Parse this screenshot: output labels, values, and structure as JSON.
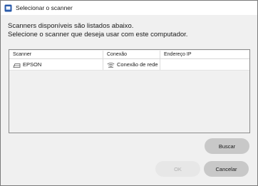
{
  "window": {
    "title": "Selecionar o scanner",
    "icon": "scanner-app-icon"
  },
  "instructions": {
    "line1": "Scanners disponíveis são listados abaixo.",
    "line2": "Selecione o scanner que deseja usar com este computador."
  },
  "table": {
    "columns": [
      "Scanner",
      "Conexão",
      "Endereço IP"
    ],
    "rows": [
      {
        "scanner": "EPSON",
        "scanner_icon": "scanner-icon",
        "connection": "Conexão de rede",
        "connection_icon": "wifi-icon",
        "ip": ""
      }
    ]
  },
  "buttons": {
    "search": "Buscar",
    "ok": "OK",
    "cancel": "Cancelar"
  },
  "colors": {
    "accent": "#2a5aa8",
    "button": "#c8c8c8",
    "button_disabled": "#e7e7e7"
  }
}
